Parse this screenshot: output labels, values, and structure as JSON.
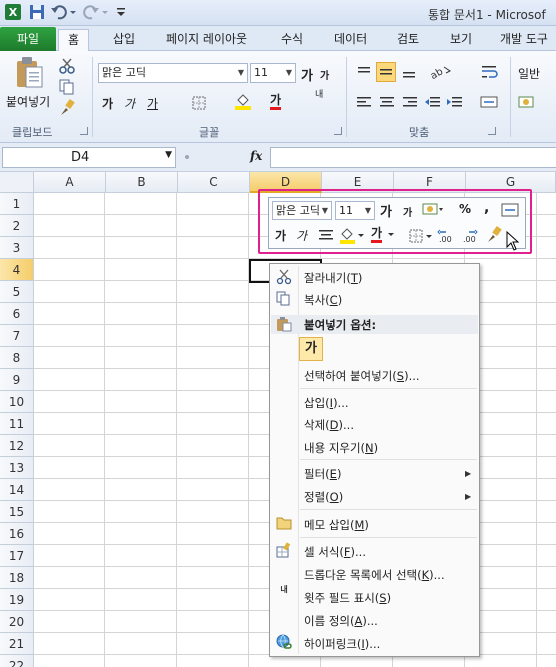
{
  "window": {
    "title": "통합 문서1 - Microsof"
  },
  "quick_access": {
    "icons": [
      "excel-icon",
      "save-icon",
      "undo-icon",
      "redo-icon",
      "customize-icon"
    ]
  },
  "ribbon_tabs": {
    "file": "파일",
    "home": "홈",
    "insert": "삽입",
    "page_layout": "페이지 레이아웃",
    "formulas": "수식",
    "data": "데이터",
    "review": "검토",
    "view": "보기",
    "developer": "개발 도구"
  },
  "ribbon": {
    "clipboard": {
      "paste_label": "붙여넣기",
      "group_label": "클립보드"
    },
    "font": {
      "font_name": "맑은 고딕",
      "font_size": "11",
      "grow": "가",
      "shrink": "가",
      "bold": "가",
      "italic": "가",
      "underline": "가",
      "font_color_glyph": "가",
      "group_label": "글꼴"
    },
    "alignment": {
      "wrap_glyph": "내",
      "group_label": "맞춤"
    },
    "number": {
      "format": "일반"
    },
    "colors": {
      "font_color": "#e8161d",
      "fill_color": "#ffe600",
      "accent_green": "#1e7b2c"
    }
  },
  "formula_bar": {
    "name_box": "D4",
    "fx": "fx",
    "value": ""
  },
  "grid": {
    "columns": [
      "A",
      "B",
      "C",
      "D",
      "E",
      "F",
      "G"
    ],
    "rows": [
      "1",
      "2",
      "3",
      "4",
      "5",
      "6",
      "7",
      "8",
      "9",
      "10",
      "11",
      "12",
      "13",
      "14",
      "15",
      "16",
      "17",
      "18",
      "19",
      "20",
      "21",
      "22"
    ],
    "selected_cell": "D4"
  },
  "mini_toolbar": {
    "font_name": "맑은 고딕",
    "font_size": "11",
    "grow": "가",
    "shrink": "가",
    "percent": "%",
    "comma": ",",
    "bold": "가",
    "italic": "가",
    "font_color_glyph": "가"
  },
  "context_menu": {
    "cut": {
      "label": "잘라내기(",
      "key": "T",
      "tail": ")"
    },
    "copy": {
      "label": "복사(",
      "key": "C",
      "tail": ")"
    },
    "paste_options_header": "붙여넣기 옵션:",
    "paste_option_glyph": "가",
    "paste_special": {
      "label": "선택하여 붙여넣기(",
      "key": "S",
      "tail": ")..."
    },
    "insert": {
      "label": "삽입(",
      "key": "I",
      "tail": ")..."
    },
    "delete": {
      "label": "삭제(",
      "key": "D",
      "tail": ")..."
    },
    "clear_contents": {
      "label": "내용 지우기(",
      "key": "N",
      "tail": ")"
    },
    "filter": {
      "label": "필터(",
      "key": "E",
      "tail": ")"
    },
    "sort": {
      "label": "정렬(",
      "key": "O",
      "tail": ")"
    },
    "insert_comment": {
      "label": "메모 삽입(",
      "key": "M",
      "tail": ")"
    },
    "format_cells": {
      "label": "셀 서식(",
      "key": "F",
      "tail": ")..."
    },
    "pick_from_list": {
      "label": "드롭다운 목록에서 선택(",
      "key": "K",
      "tail": ")..."
    },
    "phonetic": {
      "label": "윗주 필드 표시(",
      "key": "S",
      "tail": ")"
    },
    "define_name": {
      "label": "이름 정의(",
      "key": "A",
      "tail": ")..."
    },
    "hyperlink": {
      "label": "하이퍼링크(",
      "key": "I",
      "tail": ")..."
    }
  }
}
